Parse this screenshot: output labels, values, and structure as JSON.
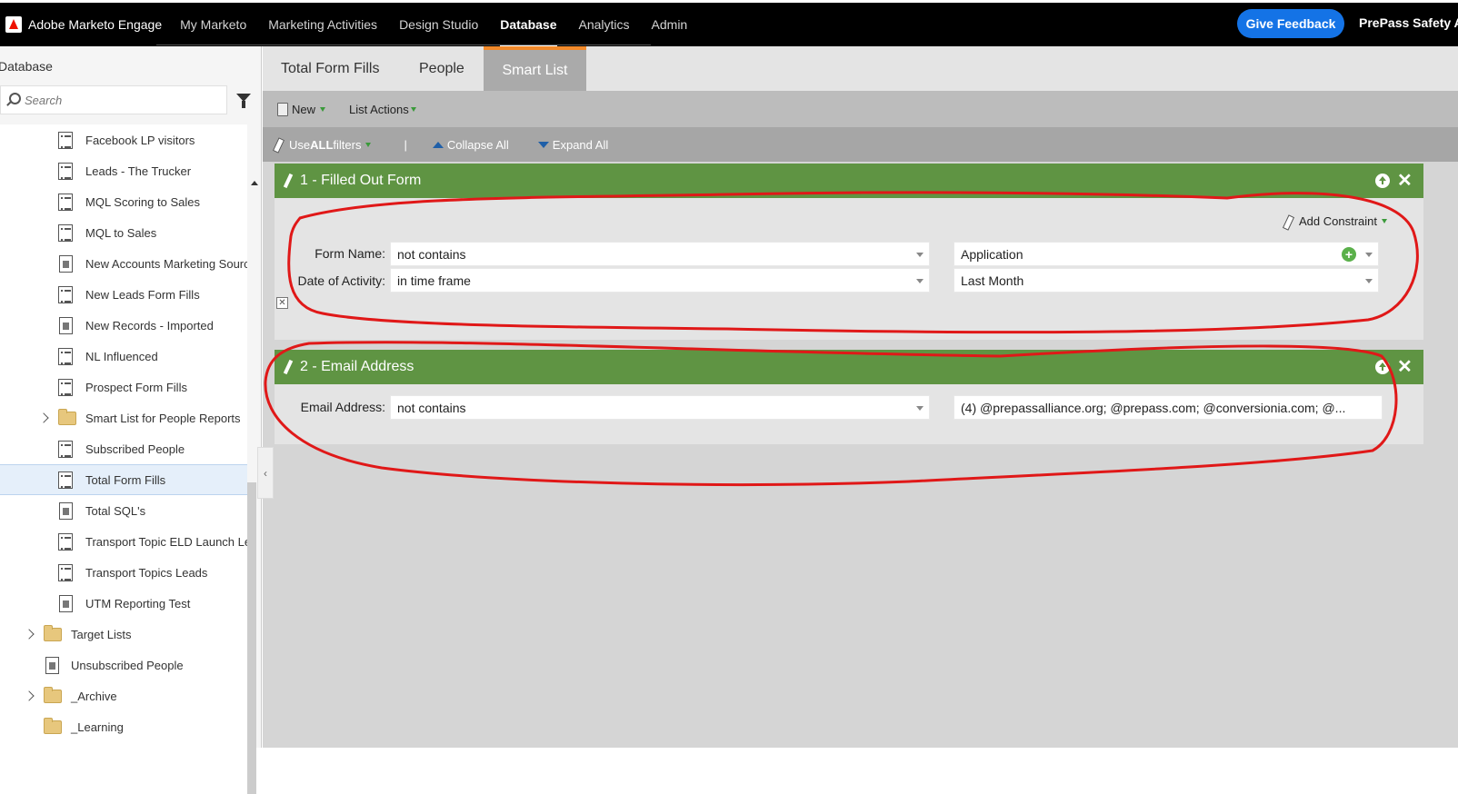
{
  "brand": {
    "name": "Adobe Marketo Engage"
  },
  "nav": {
    "items": [
      {
        "label": "My Marketo",
        "active": false
      },
      {
        "label": "Marketing Activities",
        "active": false
      },
      {
        "label": "Design Studio",
        "active": false
      },
      {
        "label": "Database",
        "active": true
      },
      {
        "label": "Analytics",
        "active": false
      },
      {
        "label": "Admin",
        "active": false
      }
    ],
    "feedback_label": "Give Feedback",
    "account_label": "PrePass Safety Allia"
  },
  "sidebar": {
    "title": "Database",
    "search_placeholder": "Search",
    "items": [
      {
        "label": "Facebook LP visitors",
        "icon": "list-icon"
      },
      {
        "label": "Leads - The Trucker",
        "icon": "list-icon"
      },
      {
        "label": "MQL Scoring to Sales",
        "icon": "list-icon"
      },
      {
        "label": "MQL to Sales",
        "icon": "list-icon"
      },
      {
        "label": "New Accounts Marketing Sourc",
        "icon": "document-icon"
      },
      {
        "label": "New Leads Form Fills",
        "icon": "list-icon"
      },
      {
        "label": "New Records - Imported",
        "icon": "document-icon"
      },
      {
        "label": "NL Influenced",
        "icon": "list-icon"
      },
      {
        "label": "Prospect Form Fills",
        "icon": "list-icon"
      },
      {
        "label": "Smart List for People Reports",
        "icon": "folder-icon"
      },
      {
        "label": "Subscribed People",
        "icon": "list-icon"
      },
      {
        "label": "Total Form Fills",
        "icon": "list-icon",
        "selected": true
      },
      {
        "label": "Total SQL's",
        "icon": "document-icon"
      },
      {
        "label": "Transport Topic ELD Launch Lea",
        "icon": "list-icon"
      },
      {
        "label": "Transport Topics Leads",
        "icon": "list-icon"
      },
      {
        "label": "UTM Reporting Test",
        "icon": "document-icon"
      },
      {
        "label": "Target Lists",
        "icon": "folder-icon"
      },
      {
        "label": "Unsubscribed People",
        "icon": "document-icon"
      },
      {
        "label": "_Archive",
        "icon": "archive-folder-icon"
      },
      {
        "label": "_Learning",
        "icon": "folder-icon"
      }
    ]
  },
  "tabs": [
    {
      "label": "Total Form Fills"
    },
    {
      "label": "People"
    },
    {
      "label": "Smart List",
      "active": true
    }
  ],
  "toolbar": {
    "new_label": "New",
    "list_actions_label": "List Actions",
    "use_filters_prefix": "Use ",
    "use_filters_bold": "ALL",
    "use_filters_suffix": " filters",
    "separator": "|",
    "collapse_label": "Collapse All",
    "expand_label": "Expand All"
  },
  "filters": [
    {
      "title": "1 - Filled Out Form",
      "add_constraint_label": "Add Constraint",
      "rows": [
        {
          "label": "Form Name:",
          "operator": "not contains",
          "value": "Application"
        },
        {
          "label": "Date of Activity:",
          "operator": "in time frame",
          "value": "Last Month"
        }
      ]
    },
    {
      "title": "2 - Email Address",
      "rows": [
        {
          "label": "Email Address:",
          "operator": "not contains",
          "value": "(4) @prepassalliance.org; @prepass.com; @conversionia.com; @..."
        }
      ]
    }
  ],
  "colors": {
    "nav_bg": "#000000",
    "feedback_btn": "#1473e6",
    "filter_header": "#5f9443",
    "active_tab_accent": "#f28a2b",
    "annotation": "#e01818"
  }
}
